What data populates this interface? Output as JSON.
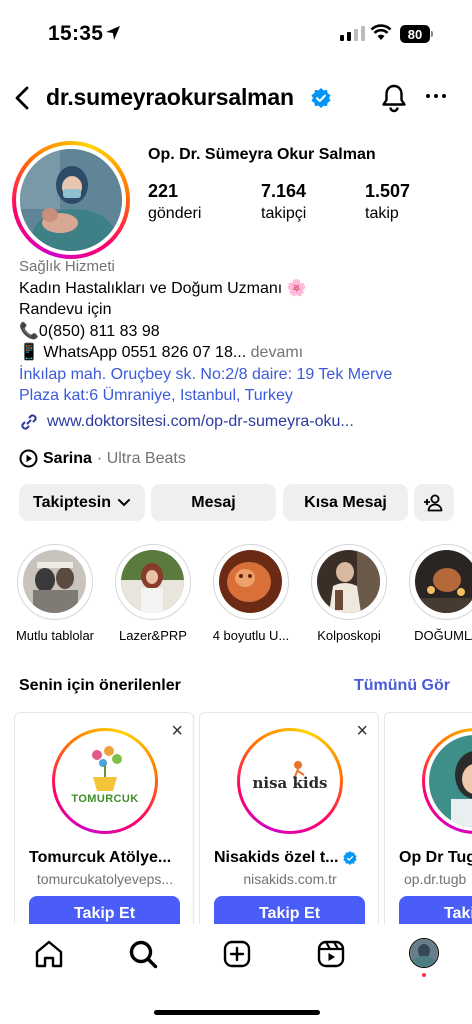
{
  "status": {
    "time": "15:35",
    "battery": "80"
  },
  "header": {
    "username": "dr.sumeyraokursalman"
  },
  "profile": {
    "display_name": "Op. Dr. Sümeyra Okur Salman",
    "stats": [
      {
        "value": "221",
        "label": "gönderi"
      },
      {
        "value": "7.164",
        "label": "takipçi"
      },
      {
        "value": "1.507",
        "label": "takip"
      }
    ],
    "category": "Sağlık Hizmeti",
    "bio_line1": "Kadın Hastalıkları ve Doğum Uzmanı 🌸",
    "bio_line2": "Randevu için",
    "bio_line3": "📞0(850) 811 83 98",
    "bio_line4": "📱 WhatsApp 0551 826 07 18...",
    "bio_more": "devamı",
    "address_line1": "İnkılap mah. Oruçbey sk. No:2/8 daire: 19 Tek Merve",
    "address_line2": "Plaza kat:6 Ümraniye, Istanbul, Turkey",
    "link": "www.doktorsitesi.com/op-dr-sumeyra-oku...",
    "music_title": "Sarina",
    "music_artist": "· Ultra Beats"
  },
  "actions": {
    "following": "Takiptesin",
    "message": "Mesaj",
    "short_message": "Kısa Mesaj"
  },
  "highlights": [
    {
      "label": "Mutlu tablolar"
    },
    {
      "label": "Lazer&PRP"
    },
    {
      "label": "4 boyutlu U..."
    },
    {
      "label": "Kolposkopi"
    },
    {
      "label": "DOĞUMLA"
    }
  ],
  "suggestions": {
    "title": "Senin için önerilenler",
    "see_all": "Tümünü Gör",
    "follow_label": "Takip Et",
    "cards": [
      {
        "name": "Tomurcuk Atölye...",
        "handle": "tomurcukatolyeveps...",
        "logo_text": "TOMURCUK"
      },
      {
        "name": "Nisakids özel t...",
        "handle": "nisakids.com.tr",
        "logo_text": "nisa kids"
      },
      {
        "name": "Op Dr Tug",
        "handle": "op.dr.tugb"
      }
    ]
  },
  "colors": {
    "link": "#2b3a9f",
    "follow_button": "#4a5df9",
    "verified": "#0095f6",
    "see_all": "#4a5bd8"
  }
}
